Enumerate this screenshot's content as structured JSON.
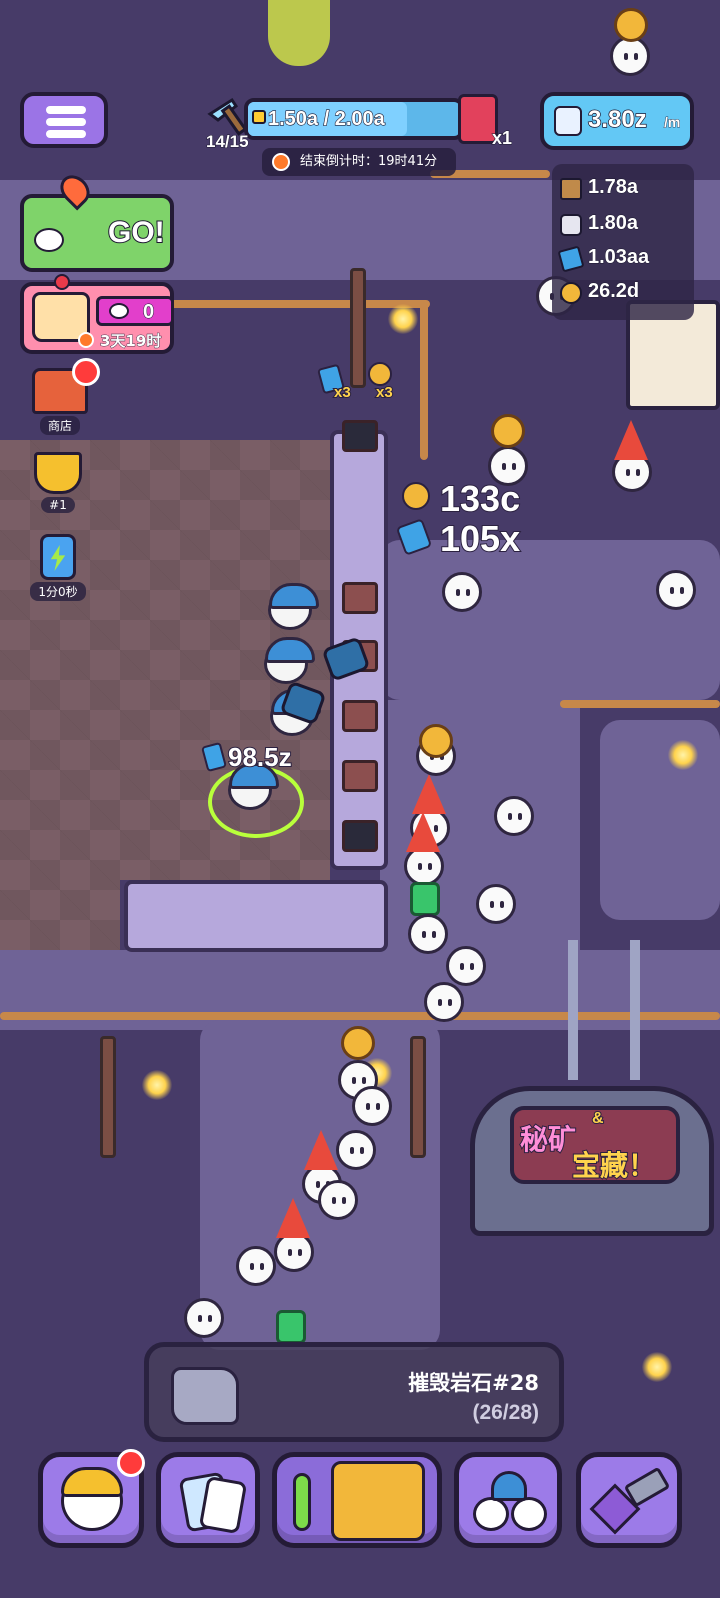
{
  "hud": {
    "pickaxes": "14/15",
    "progress_text": "1.50a / 2.00a",
    "progress_fraction": 0.75,
    "fruit_multiplier": "x1",
    "countdown_text": "结束倒计时：19时41分",
    "rate_value": "3.80z",
    "rate_unit": "/m"
  },
  "resources": [
    {
      "icon": "wood-plank-icon",
      "value": "1.78a",
      "color": "#c08a4a"
    },
    {
      "icon": "silver-ore-icon",
      "value": "1.80a",
      "color": "#e6e6f0"
    },
    {
      "icon": "blue-crystal-icon",
      "value": "1.03aa",
      "color": "#3fa3e6"
    },
    {
      "icon": "gold-nugget-icon",
      "value": "26.2d",
      "color": "#f2b73a"
    }
  ],
  "left_panel": {
    "go_label": "GO!",
    "cake_count": "0",
    "cake_timer": "3天19时",
    "shop_label": "商店",
    "rank_label": "#1",
    "boost_label": "1分0秒"
  },
  "scene": {
    "ore_label_1": "x3",
    "ore_label_2": "x3",
    "float_gold": "133c",
    "float_crystal": "105x",
    "miner_value": "98.5z",
    "event_sign_line1": "秘矿",
    "event_sign_amp": "&",
    "event_sign_line2": "宝藏！"
  },
  "task": {
    "title": "摧毁岩石#28",
    "progress": "(26/28)"
  },
  "nav": [
    {
      "name": "nav-miner-button",
      "icon": "miner-helmet-icon"
    },
    {
      "name": "nav-cards-button",
      "icon": "cards-icon"
    },
    {
      "name": "nav-mine-button",
      "icon": "mine-machine-icon"
    },
    {
      "name": "nav-team-button",
      "icon": "team-icon"
    },
    {
      "name": "nav-forge-button",
      "icon": "hammer-icon"
    }
  ],
  "colors": {
    "accent_purple": "#9c7be8",
    "progress_blue": "#5db7ea",
    "rate_blue": "#63c8f5",
    "go_green": "#7fd36a",
    "cake_pink": "#ff8fae",
    "alert_red": "#ff3b3b"
  }
}
